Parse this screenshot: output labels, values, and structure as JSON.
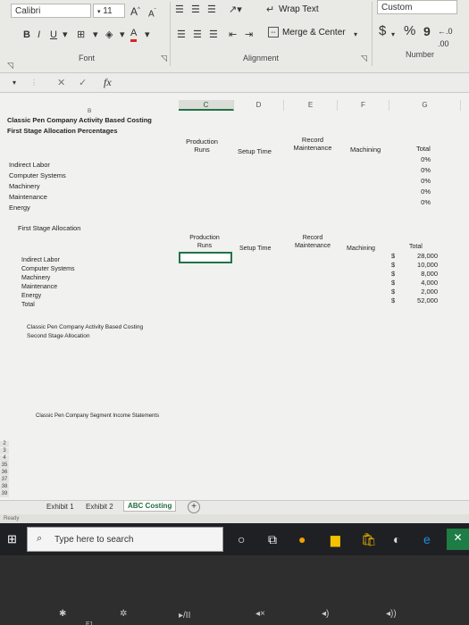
{
  "ribbon": {
    "font_name": "Calibri",
    "font_size": "11",
    "grow_font": "A",
    "shrink_font": "A",
    "bold": "B",
    "italic": "I",
    "underline": "U",
    "font_color_letter": "A",
    "wrap_text": "Wrap Text",
    "merge_center": "Merge & Center",
    "number_format": "Custom",
    "currency_symbol": "$",
    "percent_symbol": "%",
    "comma_symbol": "9",
    "group_font": "Font",
    "group_alignment": "Alignment",
    "group_number": "Number"
  },
  "formula_bar": {
    "cancel": "✕",
    "confirm": "✓",
    "fx": "fx",
    "value": ""
  },
  "columns": [
    "C",
    "D",
    "E",
    "F",
    "G"
  ],
  "sheet": {
    "col_b_label": "B",
    "title1": "Classic Pen Company Activity Based Costing",
    "title2": "First Stage Allocation Percentages",
    "table1_headers": {
      "production_line1": "Production",
      "production_line2": "Runs",
      "setup": "Setup Time",
      "record_line1": "Record",
      "record_line2": "Maintenance",
      "machining": "Machining",
      "total": "Total"
    },
    "table1_rows": [
      "Indirect Labor",
      "Computer Systems",
      "Machinery",
      "Maintenance",
      "Energy"
    ],
    "table1_totals": [
      "0%",
      "0%",
      "0%",
      "0%",
      "0%"
    ],
    "section2_title": "First Stage Allocation",
    "table2_headers": {
      "production_line1": "Production",
      "production_line2": "Runs",
      "setup": "Setup Time",
      "record_line1": "Record",
      "record_line2": "Maintenance",
      "machining": "Machining",
      "total": "Total"
    },
    "table2_rows": [
      "Indirect Labor",
      "Computer Systems",
      "Machinery",
      "Maintenance",
      "Energy",
      "Total"
    ],
    "table2_currency": [
      "$",
      "$",
      "$",
      "$",
      "$",
      "$"
    ],
    "table2_totals": [
      "28,000",
      "10,000",
      "8,000",
      "4,000",
      "2,000",
      "52,000"
    ],
    "section3_line1": "Classic Pen Company Activity Based Costing",
    "section3_line2": "Second Stage Allocation",
    "section4_title": "Classic Pen Company Segment Income Statements",
    "row_numbers": [
      "2",
      "3",
      "4",
      "35",
      "36",
      "37",
      "38",
      "39"
    ]
  },
  "tabs": [
    "Exhibit 1",
    "Exhibit 2",
    "ABC Costing"
  ],
  "add_sheet": "+",
  "status": "Ready",
  "taskbar": {
    "search_placeholder": "Type here to search"
  },
  "keyboard": {
    "k1": "F1",
    "k2": "▸/II",
    "k3": "◂×"
  }
}
